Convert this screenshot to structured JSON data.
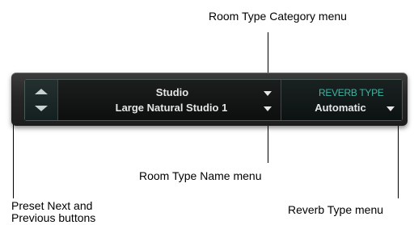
{
  "callouts": {
    "room_type_category": "Room Type Category menu",
    "room_type_name": "Room Type Name menu",
    "preset_buttons_line1": "Preset Next and",
    "preset_buttons_line2": "Previous buttons",
    "reverb_type": "Reverb Type menu"
  },
  "plugin": {
    "category_value": "Studio",
    "name_value": "Large Natural Studio 1",
    "reverb_type_label": "REVERB TYPE",
    "reverb_type_value": "Automatic"
  },
  "icons": {
    "preset_next": "up-arrow-icon",
    "preset_previous": "down-arrow-icon",
    "menu": "dropdown-triangle-icon"
  }
}
